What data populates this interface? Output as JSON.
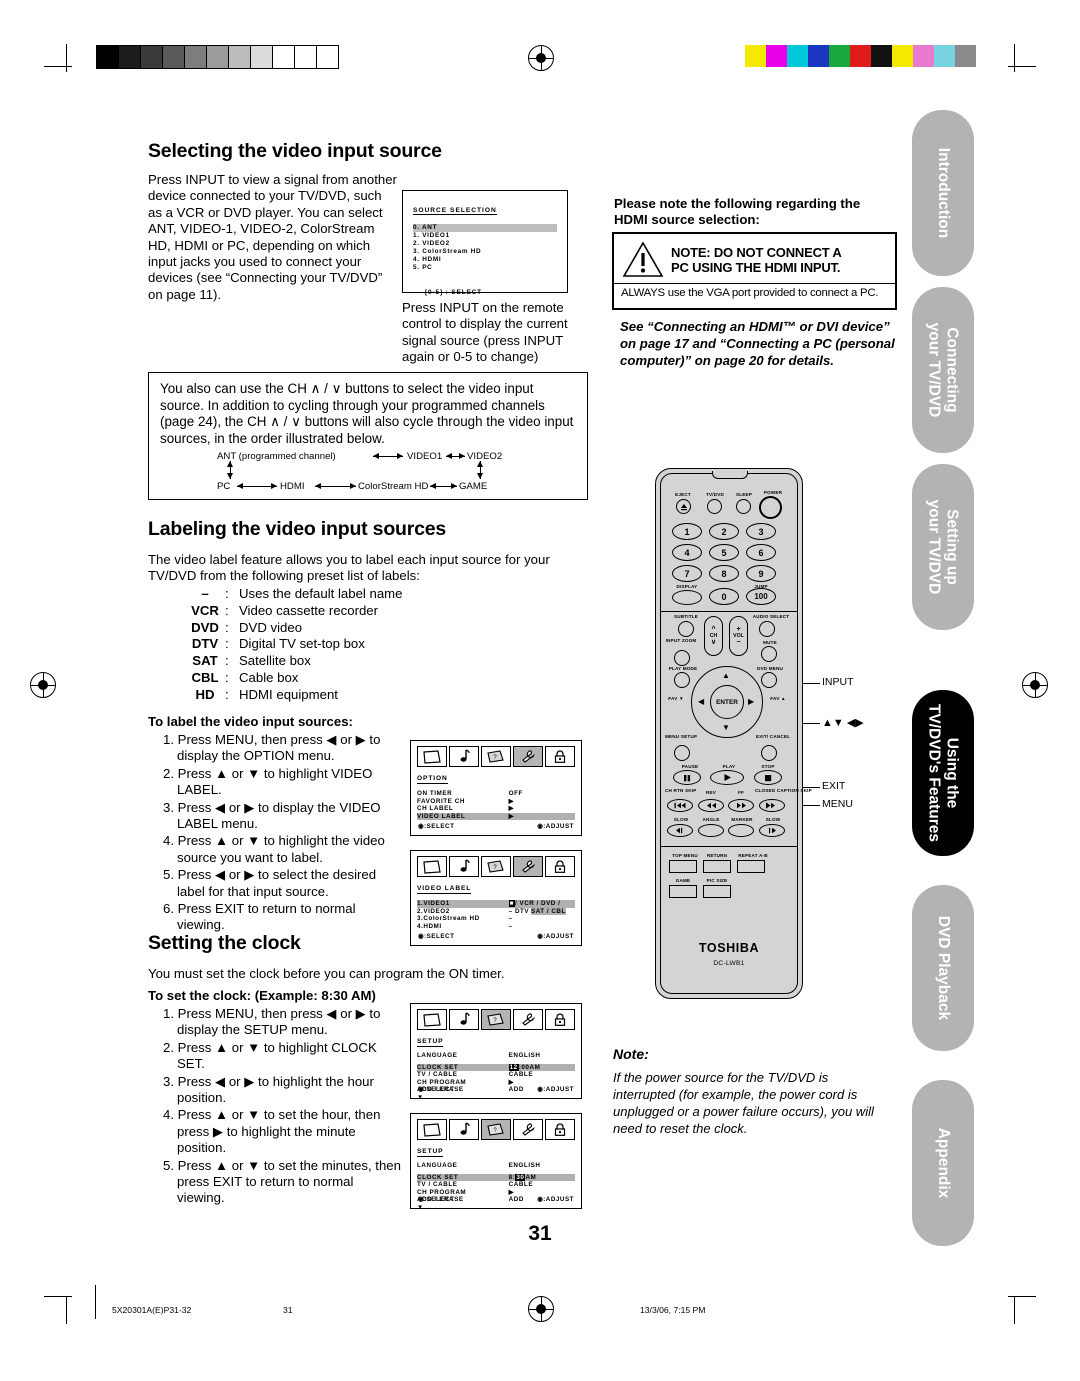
{
  "page": {
    "number": "31",
    "footer": {
      "part_number": "5X20301A(E)P31-32",
      "page_label": "31",
      "timestamp": "13/3/06, 7:15 PM"
    }
  },
  "sections": {
    "video_input": {
      "heading": "Selecting the video input source",
      "body": "Press INPUT to view a signal from another device connected to your TV/DVD, such as a VCR or DVD player. You can select ANT, VIDEO-1, VIDEO-2, ColorStream HD, HDMI or PC, depending on which input jacks you used to connect your devices (see “Connecting your TV/DVD” on page 11).",
      "caption": "Press INPUT on the remote control to display the current signal source (press INPUT again or 0-5 to change)"
    },
    "ch_box": {
      "body": "You also can use the CH ∧ / ∨ buttons to select the video input source. In addition to cycling through your programmed channels (page 24), the CH ∧ / ∨ buttons will also cycle through the video input sources, in the order illustrated below."
    },
    "labeling": {
      "heading": "Labeling the video input sources",
      "body": "The video label feature allows you to label each input source for your TV/DVD from the following preset list of labels:",
      "labels": [
        {
          "key": "–",
          "sep": ":",
          "desc": "Uses the default label name"
        },
        {
          "key": "VCR",
          "sep": ":",
          "desc": "Video cassette recorder"
        },
        {
          "key": "DVD",
          "sep": ":",
          "desc": "DVD video"
        },
        {
          "key": "DTV",
          "sep": ":",
          "desc": "Digital TV set-top box"
        },
        {
          "key": "SAT",
          "sep": ":",
          "desc": "Satellite box"
        },
        {
          "key": "CBL",
          "sep": ":",
          "desc": "Cable box"
        },
        {
          "key": "HD",
          "sep": ":",
          "desc": "HDMI equipment"
        }
      ],
      "steps_title": "To label the video input sources:",
      "steps": [
        "1. Press MENU, then press ◀ or ▶ to display the OPTION menu.",
        "2. Press ▲ or ▼ to highlight VIDEO LABEL.",
        "3. Press ◀ or ▶ to display the VIDEO LABEL menu.",
        "4. Press ▲ or ▼ to highlight the video source you want to label.",
        "5. Press ◀ or ▶  to select the desired label for that input source.",
        "6. Press EXIT to return to normal viewing."
      ]
    },
    "clock": {
      "heading": "Setting the clock",
      "body": "You must set the clock before you can program the ON timer.",
      "steps_title": "To set the clock: (Example: 8:30 AM)",
      "steps": [
        "1. Press MENU, then press ◀ or ▶ to display the SETUP menu.",
        "2. Press ▲ or ▼ to highlight CLOCK SET.",
        "3. Press ◀ or ▶ to highlight the hour position.",
        "4. Press ▲ or ▼ to set the hour, then press ▶ to highlight the minute position.",
        "5. Press ▲ or ▼ to set the minutes, then press EXIT to return to normal viewing."
      ]
    },
    "hdmi_note": {
      "intro": "Please note the following regarding the HDMI source selection:",
      "warning_line1": "NOTE: DO NOT CONNECT A",
      "warning_line2": "PC USING THE HDMI INPUT.",
      "warning_sub": "ALWAYS use the VGA port provided to connect a PC.",
      "see_also": "See “Connecting an HDMI™ or DVI device” on page 17 and “Connecting a PC (personal computer)” on page 20 for details."
    },
    "clock_note": {
      "title": "Note:",
      "body": "If the power source for the TV/DVD is interrupted (for  example, the power cord is unplugged or a power failure occurs), you will need to reset the clock."
    }
  },
  "source_selection_osd": {
    "title": "SOURCE SELECTION",
    "items": [
      {
        "text": "0. ANT",
        "highlighted": true
      },
      {
        "text": "1. VIDEO1",
        "highlighted": false
      },
      {
        "text": "2. VIDEO2",
        "highlighted": false
      },
      {
        "text": "3. ColorStream HD",
        "highlighted": false
      },
      {
        "text": "4. HDMI",
        "highlighted": false
      },
      {
        "text": "5. PC",
        "highlighted": false
      }
    ],
    "hint": "[0-5] : SELECT"
  },
  "cycle_diagram": {
    "top": [
      "ANT (programmed channel)",
      "VIDEO1",
      "VIDEO2"
    ],
    "bottom": [
      "PC",
      "HDMI",
      "ColorStream HD",
      "GAME"
    ]
  },
  "osd_menus": [
    {
      "name": "option",
      "icons": [
        "picture-icon",
        "audio-icon",
        "setup-icon",
        "option-icon",
        "lock-icon"
      ],
      "selected_icon_index": 3,
      "title": "OPTION",
      "rows": [
        {
          "key": "ON TIMER",
          "value": "OFF",
          "highlighted": false
        },
        {
          "key": "FAVORITE CH",
          "value": "▶",
          "highlighted": false
        },
        {
          "key": "CH LABEL",
          "value": "▶",
          "highlighted": false
        },
        {
          "key": "VIDEO LABEL",
          "value": "▶",
          "highlighted": true
        }
      ],
      "footer_left": ":SELECT",
      "footer_right": ":ADJUST"
    },
    {
      "name": "video-label",
      "icons": [
        "picture-icon",
        "audio-icon",
        "setup-icon",
        "option-icon",
        "lock-icon"
      ],
      "selected_icon_index": 3,
      "title": "VIDEO LABEL",
      "rows": [
        {
          "key": "1.VIDEO1",
          "value": "–",
          "highlighted": true
        },
        {
          "key": "2.VIDEO2",
          "value": "–",
          "highlighted": false
        },
        {
          "key": "3.ColorStream  HD",
          "value": "–",
          "highlighted": false
        },
        {
          "key": "4.HDMI",
          "value": "–",
          "highlighted": false
        }
      ],
      "choices_line1": "/ VCR / DVD / DTV",
      "choices_line2": "SAT / CBL",
      "footer_left": ":SELECT",
      "footer_right": ":ADJUST"
    },
    {
      "name": "setup-hour",
      "icons": [
        "picture-icon",
        "audio-icon",
        "setup-icon",
        "option-icon",
        "lock-icon"
      ],
      "selected_icon_index": 2,
      "title": "SETUP",
      "lang_key": "LANGUAGE",
      "lang_value": "ENGLISH",
      "rows": [
        {
          "key": "CLOCK SET",
          "value": "12:00AM",
          "highlighted": true,
          "chip": "12"
        },
        {
          "key": "TV / CABLE",
          "value": "CABLE",
          "highlighted": false
        },
        {
          "key": "CH PROGRAM",
          "value": "▶",
          "highlighted": false
        },
        {
          "key": "ADD / ERASE",
          "value": "ADD",
          "highlighted": false
        }
      ],
      "more": "▼",
      "footer_left": ":SELECT",
      "footer_right": ":ADJUST"
    },
    {
      "name": "setup-minute",
      "icons": [
        "picture-icon",
        "audio-icon",
        "setup-icon",
        "option-icon",
        "lock-icon"
      ],
      "selected_icon_index": 2,
      "title": "SETUP",
      "lang_key": "LANGUAGE",
      "lang_value": "ENGLISH",
      "rows": [
        {
          "key": "CLOCK SET",
          "value": "8:30AM",
          "highlighted": true,
          "chip": "30"
        },
        {
          "key": "TV / CABLE",
          "value": "CABLE",
          "highlighted": false
        },
        {
          "key": "CH PROGRAM",
          "value": "▶",
          "highlighted": false
        },
        {
          "key": "ADD / ERASE",
          "value": "ADD",
          "highlighted": false
        }
      ],
      "more": "▼",
      "footer_left": ":SELECT",
      "footer_right": ":ADJUST"
    }
  ],
  "remote": {
    "brand": "TOSHIBA",
    "model": "DC-LWB1",
    "row_top": [
      "EJECT",
      "TV/DVD",
      "SLEEP",
      "POWER"
    ],
    "numbers": [
      "1",
      "2",
      "3",
      "4",
      "5",
      "6",
      "7",
      "8",
      "9",
      "0",
      "100"
    ],
    "display_label": "DISPLAY",
    "jump_label": "JUMP",
    "row_sub": [
      "SUBTITLE",
      "AUDIO SELECT"
    ],
    "row_ch": [
      "INPUT ZOOM",
      "CH",
      "VOL",
      "MUTE"
    ],
    "row_play": [
      "PLAY MODE",
      "DVD MENU"
    ],
    "pad": {
      "center": "ENTER",
      "left_fav": "FAV ▼",
      "right_fav": "FAV ▲"
    },
    "row_menu": [
      "MENU SETUP",
      "EXIT/ CANCEL"
    ],
    "transport": [
      "PAUSE",
      "PLAY",
      "STOP"
    ],
    "row_skip": [
      "CH RTN SKIP",
      "REV",
      "FF",
      "CLOSED CAPTION SKIP"
    ],
    "row_slow": [
      "SLOW",
      "ANGLE",
      "MARKER",
      "SLOW"
    ],
    "row_rect1": [
      "TOP MENU",
      "RETURN",
      "REPEAT A-B"
    ],
    "row_rect2": [
      "GAME",
      "PIC SIZE"
    ],
    "callouts": [
      "INPUT",
      "▲▼ ◀▶",
      "EXIT",
      "MENU"
    ]
  },
  "side_tabs": [
    {
      "label": "Introduction",
      "active": false
    },
    {
      "label": "Connecting\nyour TV/DVD",
      "active": false
    },
    {
      "label": "Setting up\nyour TV/DVD",
      "active": false
    },
    {
      "label": "Using the\nTV/DVD's Features",
      "active": true
    },
    {
      "label": "DVD Playback",
      "active": false
    },
    {
      "label": "Appendix",
      "active": false
    }
  ]
}
